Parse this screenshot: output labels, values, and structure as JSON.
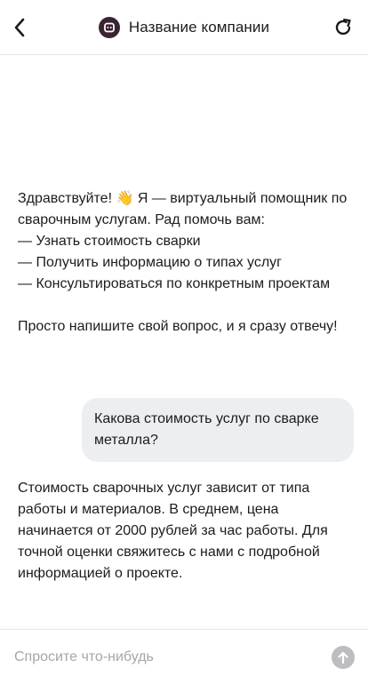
{
  "header": {
    "back_icon": "chevron-left-icon",
    "avatar_icon": "bot-face-icon",
    "title": "Название компании",
    "refresh_icon": "refresh-icon",
    "avatar_color": "#3a2433"
  },
  "messages": [
    {
      "role": "assistant",
      "text": "Здравствуйте! 👋 Я — виртуальный помощник по сварочным услугам. Рад помочь вам:\n— Узнать стоимость сварки\n— Получить информацию о типах услуг\n— Консультироваться по конкретным проектам\n\nПросто напишите свой вопрос, и я сразу отвечу!"
    },
    {
      "role": "user",
      "text": "Какова стоимость услуг по сварке металла?"
    },
    {
      "role": "assistant",
      "text": "Стоимость сварочных услуг зависит от типа работы и материалов. В среднем, цена начинается от 2000 рублей за час работы. Для точной оценки свяжитесь с нами с подробной информацией о проекте."
    }
  ],
  "composer": {
    "placeholder": "Спросите что-нибудь",
    "value": "",
    "send_icon": "arrow-up-icon"
  },
  "colors": {
    "user_bubble": "#eceef1",
    "send_disabled": "#bdbdc1",
    "divider": "#e6e6ea"
  }
}
